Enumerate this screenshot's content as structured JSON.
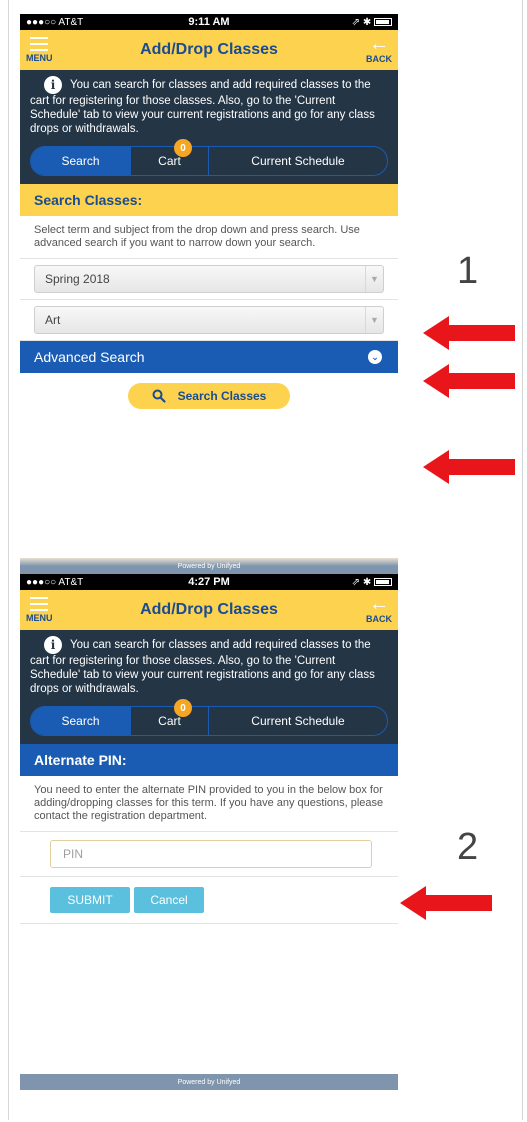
{
  "colors": {
    "yellow": "#fdd24e",
    "blue": "#1a5cb3",
    "dark_panel": "#243545",
    "arrow_red": "#e8151b",
    "badge": "#f5a623",
    "button_teal": "#5bc0de"
  },
  "screen1": {
    "status": {
      "carrier": "●●●○○ AT&T",
      "time": "9:11 AM",
      "right": "⇗ ✱"
    },
    "nav": {
      "menu_label": "MENU",
      "title": "Add/Drop Classes",
      "back_label": "BACK",
      "menu_icon": "hamburger-icon",
      "back_icon": "back-arrow-icon"
    },
    "info": {
      "icon": "info-icon",
      "text": "You can search for classes and add required classes to the cart for registering for those classes. Also, go to the 'Current Schedule' tab to view your current registrations and go for any class drops or withdrawals."
    },
    "tabs": {
      "search": "Search",
      "cart": "Cart",
      "cart_count": "0",
      "schedule": "Current Schedule"
    },
    "section_title": "Search Classes:",
    "description": "Select term and subject from the drop down and press search. Use advanced search if you want to narrow down your search.",
    "term_select": {
      "value": "Spring 2018"
    },
    "subject_select": {
      "value": "Art"
    },
    "advanced_label": "Advanced Search",
    "search_button": "Search Classes",
    "footer": "Powered by Unifyed"
  },
  "screen2": {
    "status": {
      "carrier": "●●●○○ AT&T",
      "time": "4:27 PM",
      "right": "⇗ ✱"
    },
    "nav": {
      "menu_label": "MENU",
      "title": "Add/Drop Classes",
      "back_label": "BACK"
    },
    "info": {
      "text": "You can search for classes and add required classes to the cart for registering for those classes. Also, go to the 'Current Schedule' tab to view your current registrations and go for any class drops or withdrawals."
    },
    "tabs": {
      "search": "Search",
      "cart": "Cart",
      "cart_count": "0",
      "schedule": "Current Schedule"
    },
    "section_title": "Alternate PIN:",
    "description": "You need to enter the alternate PIN provided to you in the below box for adding/dropping classes for this term. If you have any questions, please contact the registration department.",
    "pin_placeholder": "PIN",
    "submit_label": "SUBMIT",
    "cancel_label": "Cancel",
    "footer": "Powered by Unifyed"
  },
  "annotations": {
    "step1": "1",
    "step2": "2"
  }
}
